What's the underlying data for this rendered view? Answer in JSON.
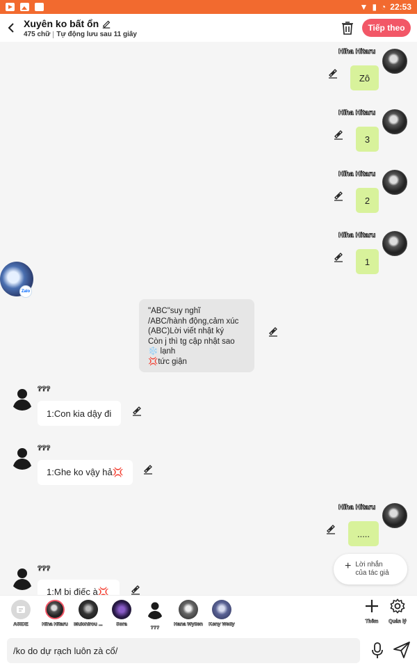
{
  "status_bar": {
    "time": "22:53"
  },
  "header": {
    "title": "Xuyên ko bất ổn",
    "word_count": "475 chữ",
    "autosave": "Tự động lưu sau 11 giây",
    "next_label": "Tiếp theo"
  },
  "messages": {
    "m1": {
      "name": "Hiha Hitaru",
      "text": "Zô"
    },
    "m2": {
      "name": "Hiha Hitaru",
      "text": "3"
    },
    "m3": {
      "name": "Hiha Hitaru",
      "text": "2"
    },
    "m4": {
      "name": "Hiha Hitaru",
      "text": "1"
    },
    "narration": {
      "lines": [
        "\"ABC\"suy nghĩ",
        "/ABC/hành động,cảm xúc",
        "(ABC)Lời viết nhật ký",
        "Còn j thì tg cập nhật sao",
        "❄️ lạnh",
        "💢tức giận"
      ],
      "badge": "Zalo"
    },
    "m6": {
      "name": "???",
      "text": "1:Con kia dậy đi"
    },
    "m7": {
      "name": "???",
      "text": "1:Ghe ko vậy hả💢"
    },
    "m8": {
      "name": "Hiha Hitaru",
      "text": "....."
    },
    "m9": {
      "name": "???",
      "text": "1:M bị điếc à💢"
    }
  },
  "author_note_button": {
    "line1": "Lời nhắn",
    "line2": "của tác giả"
  },
  "characters": [
    {
      "name": "ASIDE"
    },
    {
      "name": "Hiha Hitaru"
    },
    {
      "name": "Muichirou ..."
    },
    {
      "name": "Sora"
    },
    {
      "name": "???"
    },
    {
      "name": "Hana Wyllen"
    },
    {
      "name": "Keny Welly"
    }
  ],
  "tools": {
    "add_label": "Thêm",
    "manage_label": "Quản lý"
  },
  "composer": {
    "value": "/ko do dự rạch luôn zà cổ/"
  },
  "colors": {
    "accent": "#f25767",
    "status_bar": "#f26a2f",
    "bubble_right": "#d8f29b"
  },
  "icons": [
    "back-icon",
    "edit-pencil-icon",
    "trash-icon",
    "plus-icon",
    "gear-icon",
    "mic-icon",
    "send-icon"
  ]
}
